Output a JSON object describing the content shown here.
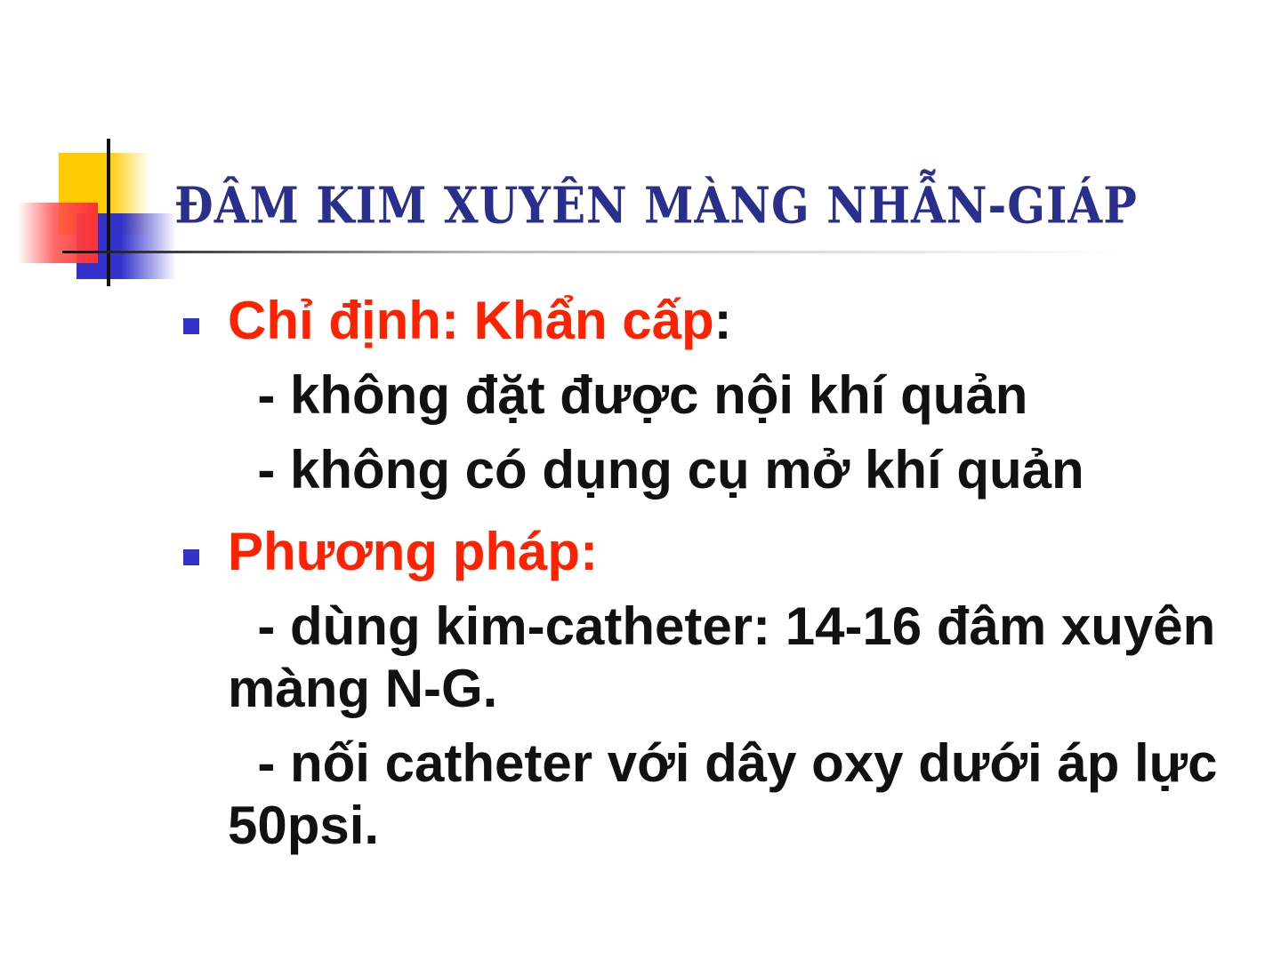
{
  "slide": {
    "title": "ĐÂM KIM XUYÊN MÀNG NHẪN-GIÁP",
    "colors": {
      "title": "#2a2e8c",
      "accent_red": "#ff2200",
      "bullet": "#3333cc",
      "text": "#111111",
      "deco_yellow": "#ffcc00",
      "deco_blue": "#3333cc",
      "deco_red": "#ff3333"
    },
    "sections": [
      {
        "heading": "Chỉ định: Khẩn cấp",
        "heading_suffix": ":",
        "items": [
          "  - không đặt được nội khí quản",
          "  - không có dụng cụ mở khí quản"
        ]
      },
      {
        "heading": "Phương pháp:",
        "heading_suffix": "",
        "items": [
          "  - dùng kim-catheter: 14-16 đâm xuyên màng N-G.",
          "  - nối catheter với dây oxy dưới áp lực 50psi."
        ]
      }
    ]
  }
}
